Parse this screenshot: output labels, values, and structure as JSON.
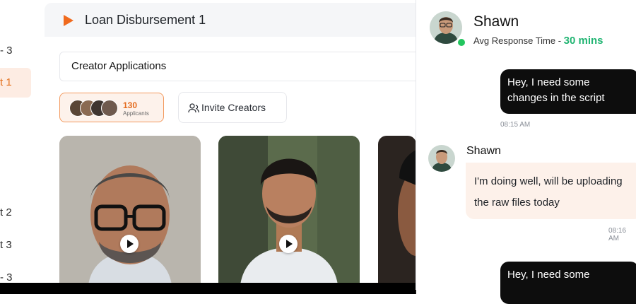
{
  "sidebar": {
    "items": [
      {
        "label": "- 3"
      },
      {
        "label": "t 1"
      },
      {
        "label": "t 2"
      },
      {
        "label": "t 3"
      },
      {
        "label": "- 3"
      }
    ]
  },
  "main": {
    "title": "Loan Disbursement 1",
    "section_title": "Creator Applications",
    "applicants": {
      "count": "130",
      "label": "Applicants"
    },
    "invite_label": "Invite Creators"
  },
  "chat": {
    "name": "Shawn",
    "response_label": "Avg Response Time - ",
    "response_value": "30 mins",
    "messages": [
      {
        "text": "Hey, I need some changes in the script",
        "time": "08:15 AM"
      },
      {
        "sender": "Shawn",
        "text": "I'm doing well, will be uploading the raw files today",
        "time": "08:16 AM"
      },
      {
        "text": "Hey, I need some"
      }
    ]
  },
  "colors": {
    "accent": "#f06a1d",
    "online": "#22c55e",
    "response_time": "#22b573",
    "bubble_dark": "#0d0d0d",
    "bubble_light": "#fdf1ea"
  },
  "icons": [
    "play-icon",
    "invite-users-icon",
    "video-play-icon",
    "online-status-icon"
  ]
}
